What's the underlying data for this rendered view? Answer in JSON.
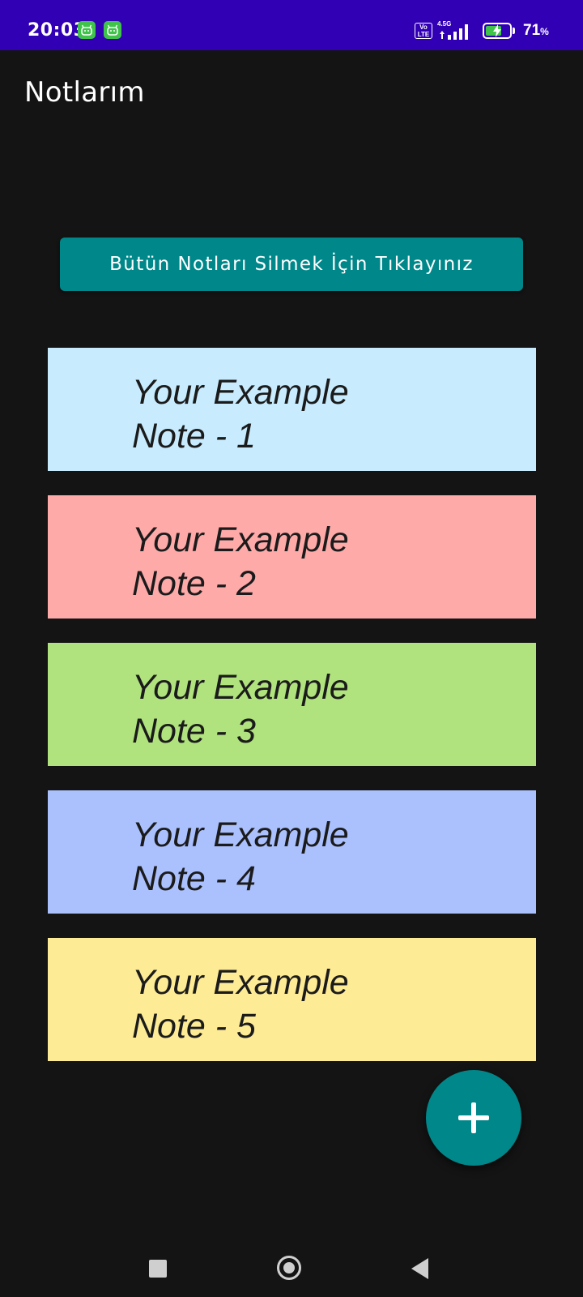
{
  "status_bar": {
    "time": "20:03",
    "volte_label_top": "Vo",
    "volte_label_bottom": "LTE",
    "network_type": "4.5G",
    "battery_level": "71",
    "battery_unit": "%",
    "battery_fill_fraction": 0.71,
    "icons": [
      "android-notification-icon",
      "android-notification-icon",
      "volte-icon",
      "signal-icon",
      "battery-charging-icon"
    ]
  },
  "app_bar": {
    "title": "Notlarım"
  },
  "actions": {
    "delete_all_label": "Bütün Notları Silmek İçin Tıklayınız"
  },
  "notes": [
    {
      "line1": "Your Example",
      "line2": "Note - 1",
      "color": "#c8ecfe"
    },
    {
      "line1": "Your Example",
      "line2": "Note - 2",
      "color": "#fdaaa9"
    },
    {
      "line1": "Your Example",
      "line2": "Note - 3",
      "color": "#b0e37d"
    },
    {
      "line1": "Your Example",
      "line2": "Note - 4",
      "color": "#abc1fe"
    },
    {
      "line1": "Your Example",
      "line2": "Note - 5",
      "color": "#feeb95"
    }
  ],
  "fab": {
    "icon": "plus-icon",
    "color": "#00878a"
  },
  "nav_bar": {
    "icons": [
      "recents-square-icon",
      "home-circle-icon",
      "back-triangle-icon"
    ]
  },
  "colors": {
    "status_bar": "#3200b4",
    "background": "#141414",
    "accent": "#00878a"
  }
}
